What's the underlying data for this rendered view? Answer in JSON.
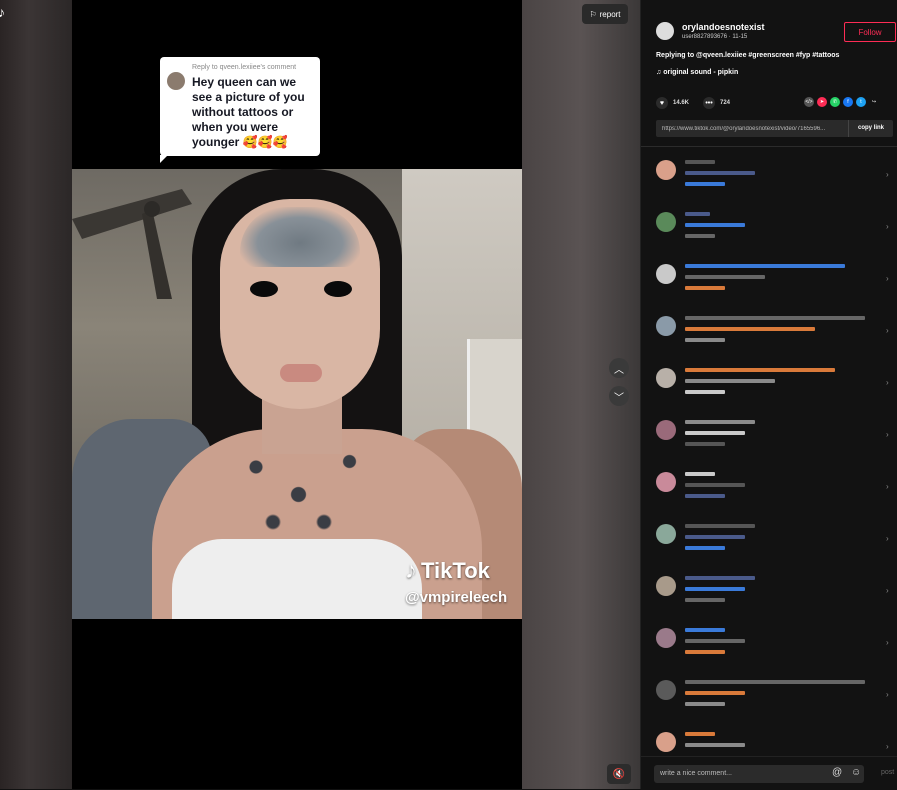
{
  "video": {
    "report_label": "report",
    "watermark_brand": "TikTok",
    "watermark_handle": "@vmpireleech"
  },
  "reply_bubble": {
    "meta": "Reply to qveen.lexiiee's comment",
    "text": "Hey queen can we see a picture of you without tattoos or when you were younger 🥰🥰🥰"
  },
  "author": {
    "username": "orylandoesnotexist",
    "meta": "user8827893676 · 11-15",
    "follow_label": "Follow"
  },
  "caption": "Replying to @qveen.lexiiee #greenscreen #fyp #tattoos",
  "sound": "original sound - pipkin",
  "stats": {
    "likes": "14.6K",
    "comments": "724"
  },
  "link": {
    "url": "https://www.tiktok.com/@orylandoesnotexist/video/7165596...",
    "copy_label": "copy link"
  },
  "comment_bar": {
    "placeholder": "write a nice comment...",
    "post_label": "post"
  },
  "colors": {
    "accent": "#fe2c55",
    "panel_bg": "#121212"
  }
}
